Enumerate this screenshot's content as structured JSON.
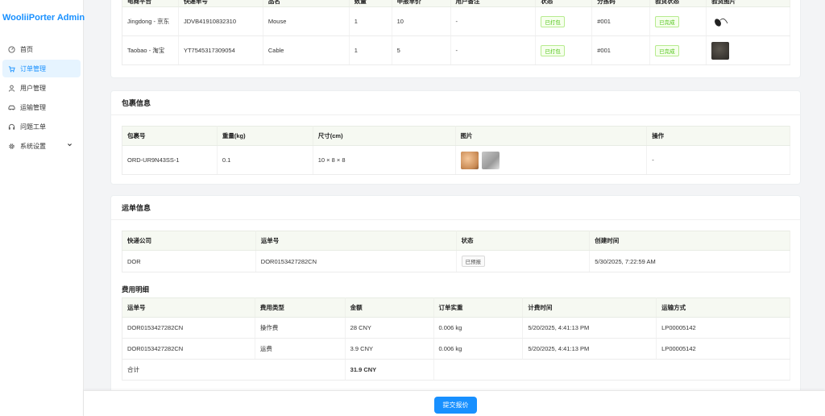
{
  "app": {
    "title": "WooliiPorter Admin"
  },
  "sidebar": {
    "items": [
      {
        "label": "首页",
        "icon": "dashboard-icon"
      },
      {
        "label": "订单管理",
        "icon": "cart-icon",
        "active": true
      },
      {
        "label": "用户管理",
        "icon": "user-icon"
      },
      {
        "label": "运输管理",
        "icon": "car-icon"
      },
      {
        "label": "问题工单",
        "icon": "headset-icon"
      },
      {
        "label": "系统设置",
        "icon": "gear-icon",
        "expandable": true
      }
    ]
  },
  "items_table": {
    "headers": [
      "电商平台",
      "快递单号",
      "品名",
      "数量",
      "申报单价",
      "用户备注",
      "状态",
      "分拣码",
      "验货状态",
      "验货图片"
    ],
    "rows": [
      {
        "platform": "Jingdong - 京东",
        "tracking": "JDVB41910832310",
        "name": "Mouse",
        "qty": "1",
        "price": "10",
        "remark": "-",
        "status": "已打包",
        "sort_code": "#001",
        "inspect": "已完成",
        "image": "mouse-photo"
      },
      {
        "platform": "Taobao - 淘宝",
        "tracking": "YT7545317309054",
        "name": "Cable",
        "qty": "1",
        "price": "5",
        "remark": "-",
        "status": "已打包",
        "sort_code": "#001",
        "inspect": "已完成",
        "image": "cable-photo"
      }
    ]
  },
  "package": {
    "title": "包裹信息",
    "headers": [
      "包裹号",
      "重量(kg)",
      "尺寸(cm)",
      "图片",
      "操作"
    ],
    "rows": [
      {
        "id": "ORD-UR9N43SS-1",
        "weight": "0.1",
        "size": "10 × 8 × 8",
        "action": "-"
      }
    ]
  },
  "waybill": {
    "title": "运单信息",
    "headers": [
      "快递公司",
      "运单号",
      "状态",
      "创建时间"
    ],
    "rows": [
      {
        "carrier": "DOR",
        "number": "DOR0153427282CN",
        "status": "已预报",
        "created": "5/30/2025, 7:22:59 AM"
      }
    ]
  },
  "fees": {
    "title": "费用明细",
    "headers": [
      "运单号",
      "费用类型",
      "金额",
      "订单实重",
      "计费时间",
      "运输方式"
    ],
    "rows": [
      {
        "number": "DOR0153427282CN",
        "type": "操作费",
        "amount": "28 CNY",
        "weight": "0.006 kg",
        "time": "5/20/2025, 4:41:13 PM",
        "method": "LP00005142"
      },
      {
        "number": "DOR0153427282CN",
        "type": "运费",
        "amount": "3.9 CNY",
        "weight": "0.006 kg",
        "time": "5/20/2025, 4:41:13 PM",
        "method": "LP00005142"
      }
    ],
    "total_label": "合计",
    "total_amount": "31.9 CNY"
  },
  "footer": {
    "submit_label": "提交报价"
  },
  "colors": {
    "accent": "#1890ff",
    "tag_green": "#52c41a",
    "header_bg": "#f6f9f2"
  }
}
